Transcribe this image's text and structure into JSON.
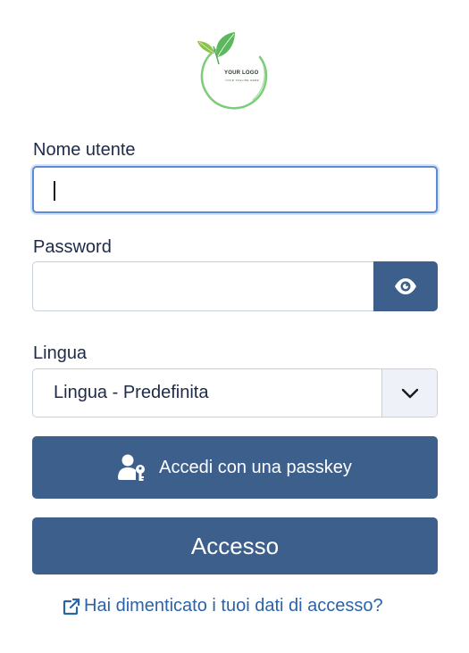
{
  "logo": {
    "text": "YOUR LOGO",
    "tagline": "YOUR TAGLINE HERE",
    "colors": {
      "leaf_dark": "#4caf50",
      "leaf_light": "#8bc34a",
      "ring": "#7ccc7a"
    }
  },
  "form": {
    "username": {
      "label": "Nome utente",
      "value": "",
      "placeholder": ""
    },
    "password": {
      "label": "Password",
      "value": "",
      "placeholder": "",
      "toggle_icon": "eye-icon"
    },
    "language": {
      "label": "Lingua",
      "selected": "Lingua - Predefinita",
      "icon": "chevron-down-icon"
    }
  },
  "buttons": {
    "passkey": {
      "label": "Accedi con una passkey",
      "icon": "user-key-icon"
    },
    "login": {
      "label": "Accesso"
    }
  },
  "links": {
    "forgot": {
      "label": "Hai dimenticato i tuoi dati di accesso?",
      "icon": "external-link-icon"
    }
  },
  "theme": {
    "primary": "#3d5f8c",
    "link": "#2b63a8",
    "text": "#1d2a48",
    "focus": "#5b8ad6"
  }
}
